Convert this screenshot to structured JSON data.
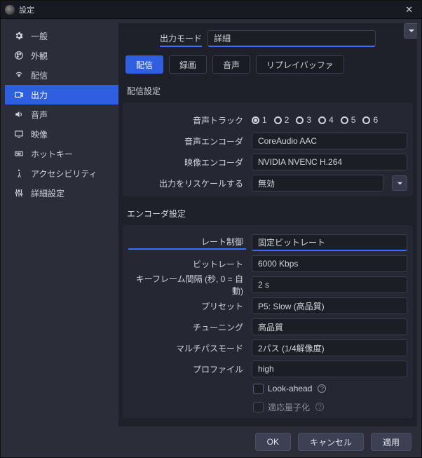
{
  "window": {
    "title": "設定"
  },
  "sidebar": {
    "items": [
      {
        "label": "一般",
        "icon": "gear-icon"
      },
      {
        "label": "外観",
        "icon": "paint-icon"
      },
      {
        "label": "配信",
        "icon": "antenna-icon"
      },
      {
        "label": "出力",
        "icon": "output-icon"
      },
      {
        "label": "音声",
        "icon": "speaker-icon"
      },
      {
        "label": "映像",
        "icon": "monitor-icon"
      },
      {
        "label": "ホットキー",
        "icon": "keyboard-icon"
      },
      {
        "label": "アクセシビリティ",
        "icon": "accessibility-icon"
      },
      {
        "label": "詳細設定",
        "icon": "tools-icon"
      }
    ],
    "active_index": 3
  },
  "mode": {
    "label": "出力モード",
    "value": "詳細"
  },
  "tabs": [
    {
      "label": "配信"
    },
    {
      "label": "録画"
    },
    {
      "label": "音声"
    },
    {
      "label": "リプレイバッファ"
    }
  ],
  "active_tab": 0,
  "stream": {
    "group_title": "配信設定",
    "audio_track_label": "音声トラック",
    "tracks": [
      {
        "n": "1",
        "selected": true
      },
      {
        "n": "2",
        "selected": false
      },
      {
        "n": "3",
        "selected": false
      },
      {
        "n": "4",
        "selected": false
      },
      {
        "n": "5",
        "selected": false
      },
      {
        "n": "6",
        "selected": false
      }
    ],
    "audio_enc_label": "音声エンコーダ",
    "audio_enc_value": "CoreAudio AAC",
    "video_enc_label": "映像エンコーダ",
    "video_enc_value": "NVIDIA NVENC H.264",
    "rescale_label": "出力をリスケールする",
    "rescale_value": "無効"
  },
  "encoder": {
    "group_title": "エンコーダ設定",
    "rate_label": "レート制御",
    "rate_value": "固定ビットレート",
    "bitrate_label": "ビットレート",
    "bitrate_value": "6000 Kbps",
    "keyframe_label": "キーフレーム間隔 (秒, 0 = 自動)",
    "keyframe_value": "2 s",
    "preset_label": "プリセット",
    "preset_value": "P5: Slow (高品質)",
    "tuning_label": "チューニング",
    "tuning_value": "高品質",
    "multipass_label": "マルチパスモード",
    "multipass_value": "2パス (1/4解像度)",
    "profile_label": "プロファイル",
    "profile_value": "high",
    "lookahead_label": "Look-ahead",
    "psycho_label": "適応量子化"
  },
  "footer": {
    "ok": "OK",
    "cancel": "キャンセル",
    "apply": "適用"
  }
}
